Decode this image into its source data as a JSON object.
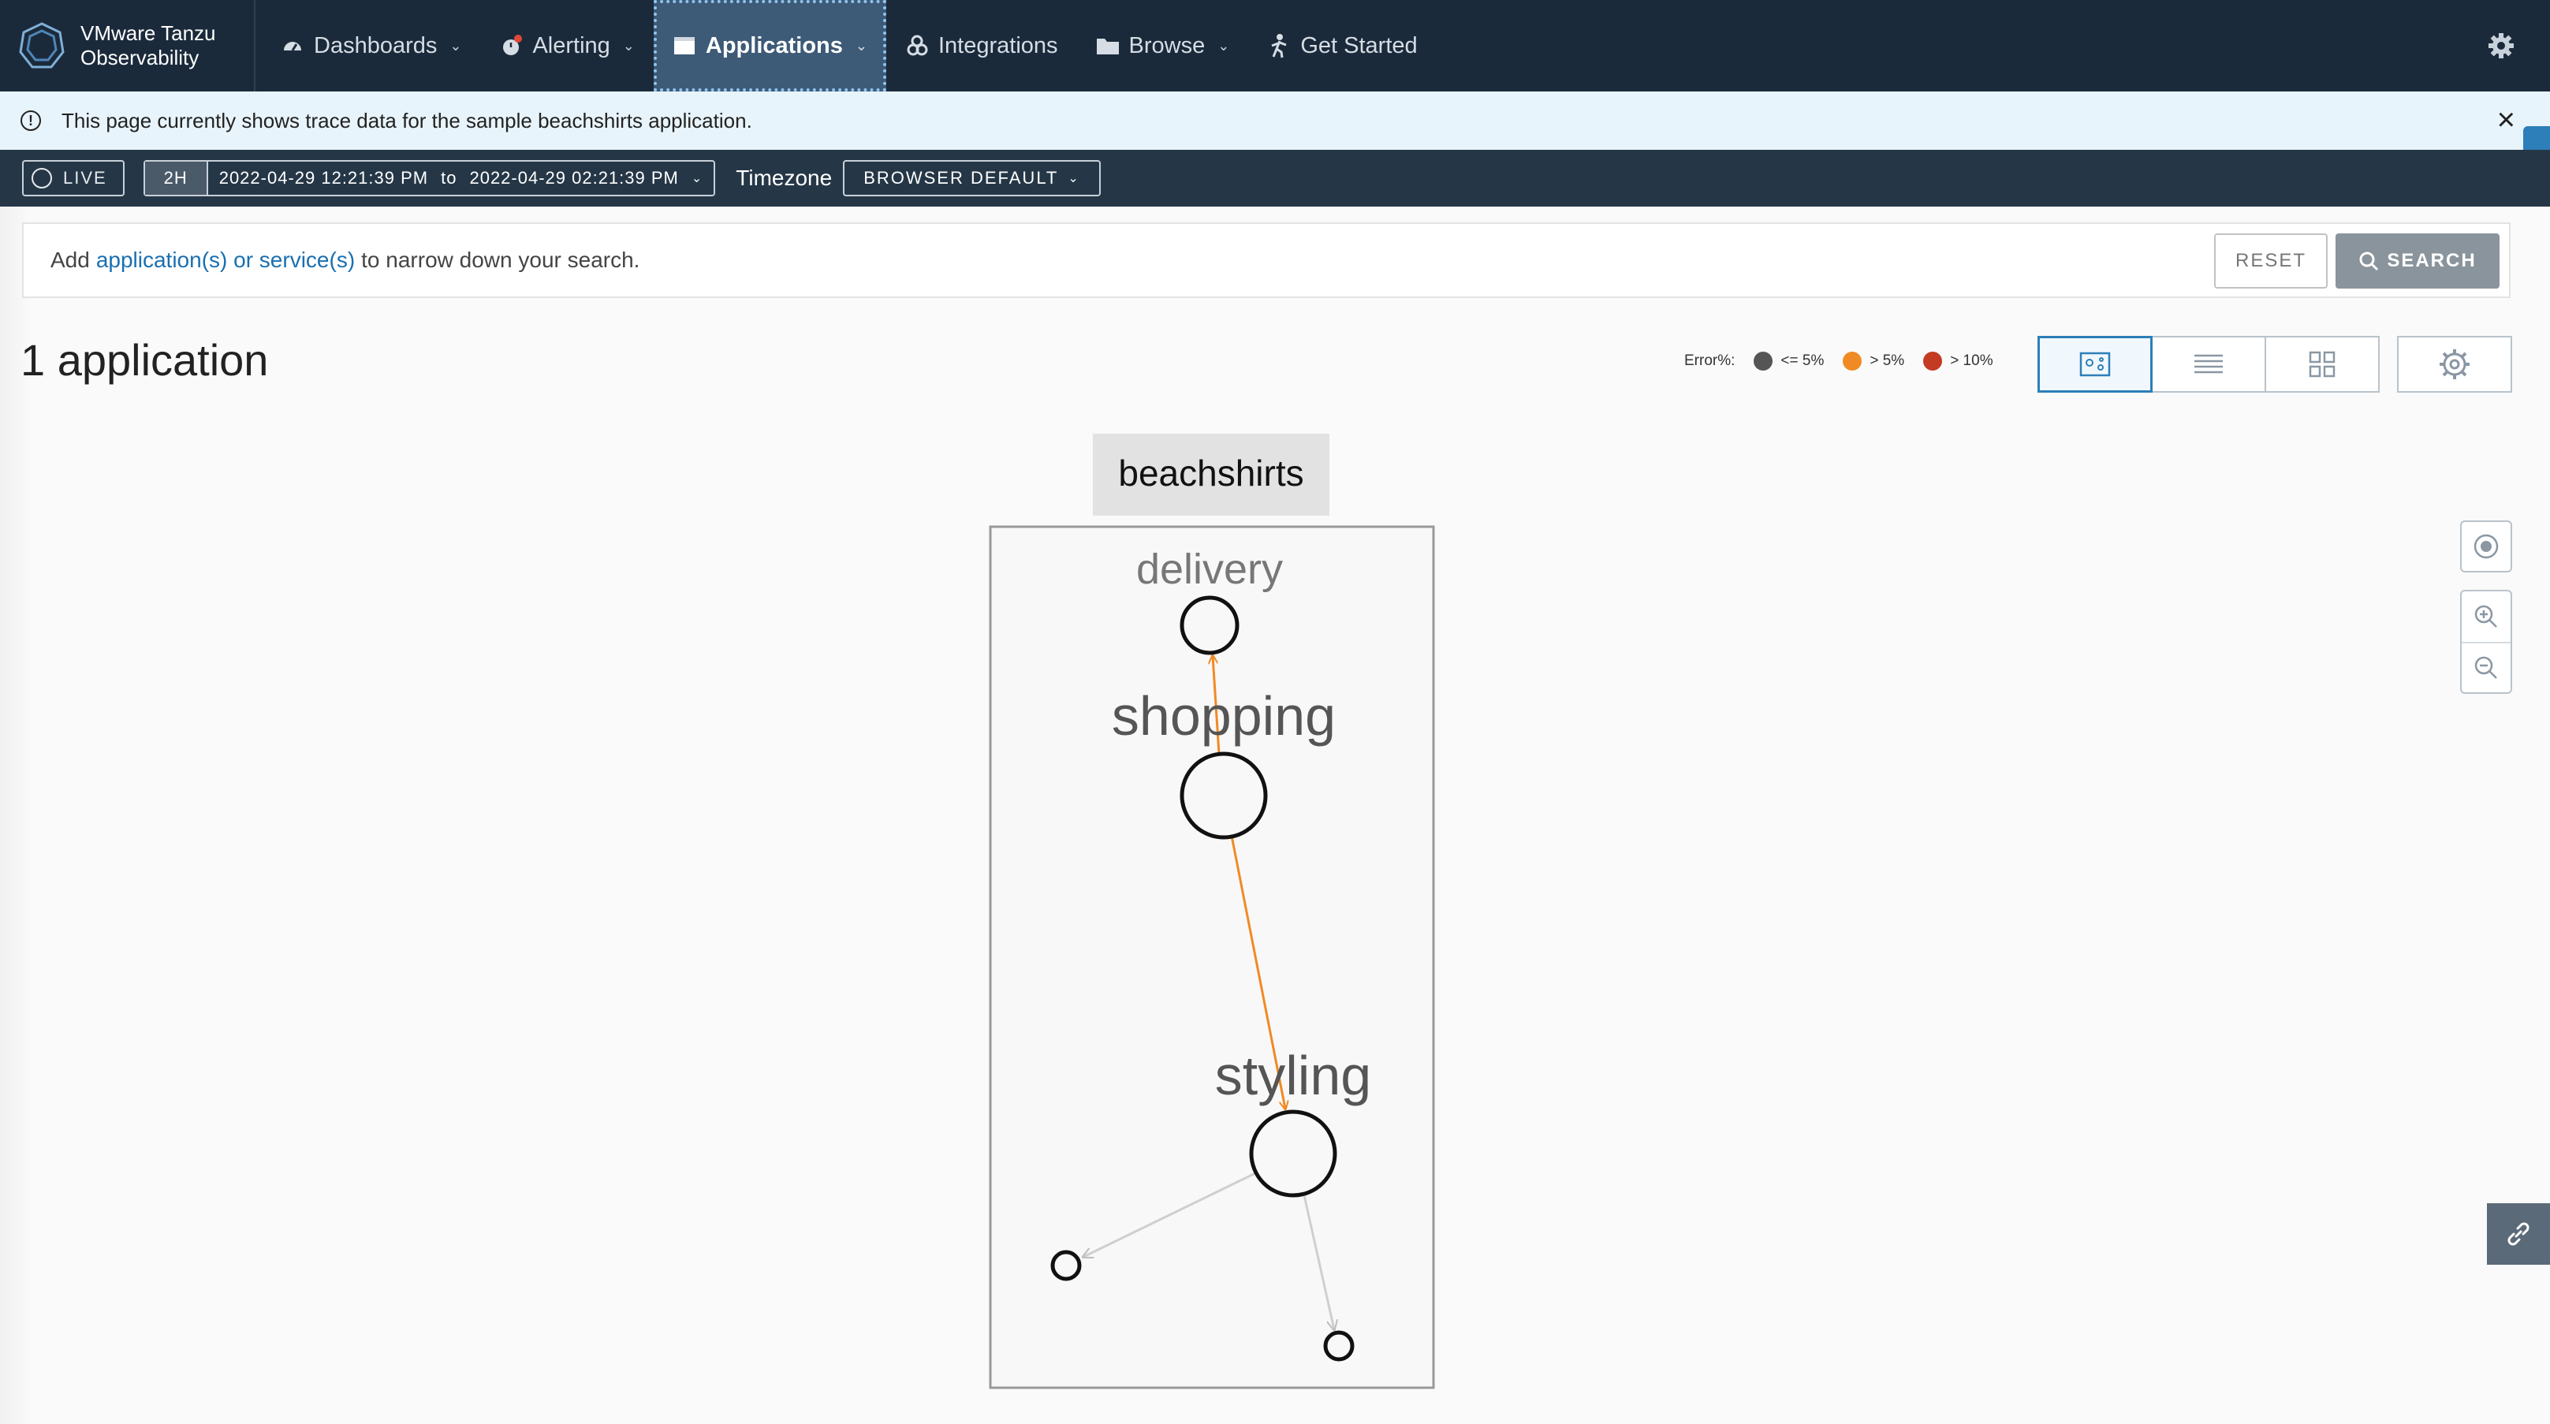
{
  "brand": {
    "line1": "VMware Tanzu",
    "line2": "Observability"
  },
  "nav": {
    "items": [
      {
        "label": "Dashboards",
        "icon": "dashboard-gauge-icon",
        "has_dropdown": true
      },
      {
        "label": "Alerting",
        "icon": "alarm-clock-icon",
        "has_dropdown": true
      },
      {
        "label": "Applications",
        "icon": "window-icon",
        "has_dropdown": true,
        "active": true
      },
      {
        "label": "Integrations",
        "icon": "integrations-icon",
        "has_dropdown": false
      },
      {
        "label": "Browse",
        "icon": "folder-icon",
        "has_dropdown": true
      },
      {
        "label": "Get Started",
        "icon": "person-walking-icon",
        "has_dropdown": false
      }
    ],
    "settings_icon": "gear-icon"
  },
  "banner": {
    "text": "This page currently shows trace data for the sample beachshirts application.",
    "close_icon": "close-icon",
    "help_label": "?"
  },
  "timebar": {
    "live_label": "LIVE",
    "duration": "2H",
    "start": "2022-04-29 12:21:39 PM",
    "to_label": "to",
    "end": "2022-04-29 02:21:39 PM",
    "timezone_label": "Timezone",
    "timezone_value": "BROWSER DEFAULT"
  },
  "search": {
    "prefix": "Add",
    "link_text": "application(s) or service(s)",
    "suffix": "to narrow down your search.",
    "reset_label": "RESET",
    "search_label": "SEARCH"
  },
  "results": {
    "title": "1 application"
  },
  "legend": {
    "title": "Error%:",
    "items": [
      {
        "label": "<= 5%",
        "color": "#555555"
      },
      {
        "label": "> 5%",
        "color": "#f08a24"
      },
      {
        "label": "> 10%",
        "color": "#c23b22"
      }
    ]
  },
  "view_modes": [
    "map-view-icon",
    "list-view-icon",
    "grid-view-icon"
  ],
  "graph": {
    "application": "beachshirts",
    "services": [
      {
        "name": "delivery",
        "label_size": "small"
      },
      {
        "name": "shopping",
        "label_size": "large"
      },
      {
        "name": "styling",
        "label_size": "large"
      }
    ],
    "edges": [
      {
        "from": "shopping",
        "to": "delivery",
        "status": "> 5%"
      },
      {
        "from": "shopping",
        "to": "styling",
        "status": "> 5%"
      }
    ],
    "colors": {
      "warn_edge": "#f08a24",
      "plain_edge": "#c8c8c8"
    }
  },
  "controls": [
    "recenter-icon",
    "zoom-in-icon",
    "zoom-out-icon",
    "link-icon"
  ]
}
